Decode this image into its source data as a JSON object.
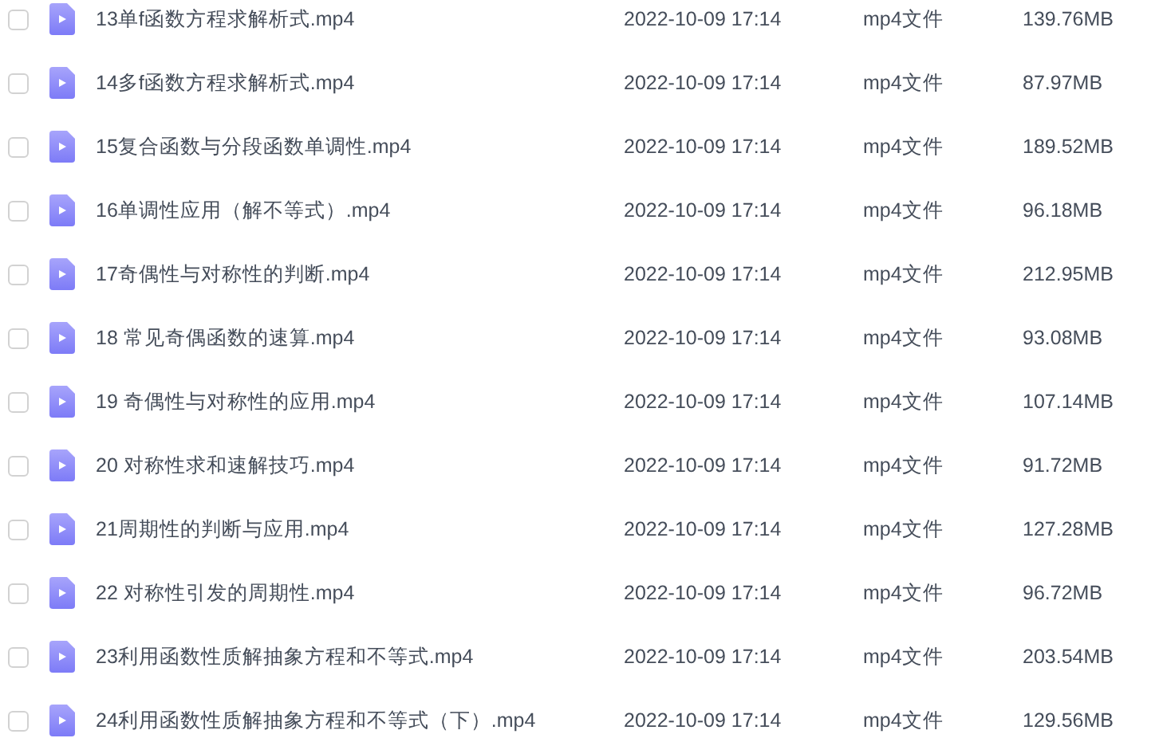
{
  "files": [
    {
      "name": "13单f函数方程求解析式.mp4",
      "modified": "2022-10-09 17:14",
      "type": "mp4文件",
      "size": "139.76MB",
      "checked": false
    },
    {
      "name": "14多f函数方程求解析式.mp4",
      "modified": "2022-10-09 17:14",
      "type": "mp4文件",
      "size": "87.97MB",
      "checked": false
    },
    {
      "name": "15复合函数与分段函数单调性.mp4",
      "modified": "2022-10-09 17:14",
      "type": "mp4文件",
      "size": "189.52MB",
      "checked": false
    },
    {
      "name": "16单调性应用（解不等式）.mp4",
      "modified": "2022-10-09 17:14",
      "type": "mp4文件",
      "size": "96.18MB",
      "checked": false
    },
    {
      "name": "17奇偶性与对称性的判断.mp4",
      "modified": "2022-10-09 17:14",
      "type": "mp4文件",
      "size": "212.95MB",
      "checked": false
    },
    {
      "name": "18 常见奇偶函数的速算.mp4",
      "modified": "2022-10-09 17:14",
      "type": "mp4文件",
      "size": "93.08MB",
      "checked": false
    },
    {
      "name": "19 奇偶性与对称性的应用.mp4",
      "modified": "2022-10-09 17:14",
      "type": "mp4文件",
      "size": "107.14MB",
      "checked": false
    },
    {
      "name": "20 对称性求和速解技巧.mp4",
      "modified": "2022-10-09 17:14",
      "type": "mp4文件",
      "size": "91.72MB",
      "checked": false
    },
    {
      "name": "21周期性的判断与应用.mp4",
      "modified": "2022-10-09 17:14",
      "type": "mp4文件",
      "size": "127.28MB",
      "checked": false
    },
    {
      "name": "22 对称性引发的周期性.mp4",
      "modified": "2022-10-09 17:14",
      "type": "mp4文件",
      "size": "96.72MB",
      "checked": false
    },
    {
      "name": "23利用函数性质解抽象方程和不等式.mp4",
      "modified": "2022-10-09 17:14",
      "type": "mp4文件",
      "size": "203.54MB",
      "checked": false
    },
    {
      "name": "24利用函数性质解抽象方程和不等式（下）.mp4",
      "modified": "2022-10-09 17:14",
      "type": "mp4文件",
      "size": "129.56MB",
      "checked": false
    }
  ]
}
